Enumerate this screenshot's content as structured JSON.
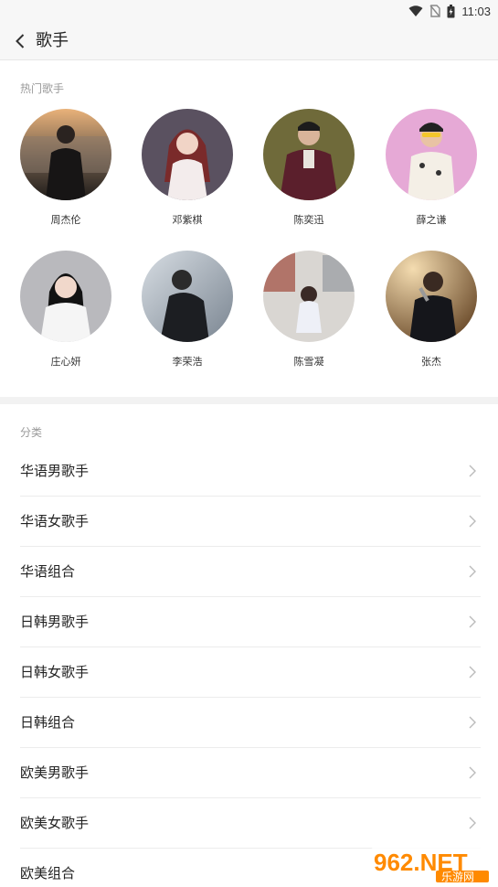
{
  "status_bar": {
    "time": "11:03"
  },
  "header": {
    "title": "歌手"
  },
  "hot_artists": {
    "label": "热门歌手",
    "items": [
      {
        "name": "周杰伦",
        "icon": "artist-photo"
      },
      {
        "name": "邓紫棋",
        "icon": "artist-photo"
      },
      {
        "name": "陈奕迅",
        "icon": "artist-photo"
      },
      {
        "name": "薛之谦",
        "icon": "artist-photo"
      },
      {
        "name": "庄心妍",
        "icon": "artist-photo"
      },
      {
        "name": "李荣浩",
        "icon": "artist-photo"
      },
      {
        "name": "陈雪凝",
        "icon": "artist-photo"
      },
      {
        "name": "张杰",
        "icon": "artist-photo"
      }
    ]
  },
  "categories": {
    "label": "分类",
    "items": [
      {
        "label": "华语男歌手"
      },
      {
        "label": "华语女歌手"
      },
      {
        "label": "华语组合"
      },
      {
        "label": "日韩男歌手"
      },
      {
        "label": "日韩女歌手"
      },
      {
        "label": "日韩组合"
      },
      {
        "label": "欧美男歌手"
      },
      {
        "label": "欧美女歌手"
      },
      {
        "label": "欧美组合"
      }
    ]
  },
  "watermark": {
    "main": "962.NET",
    "sub": "乐游网"
  },
  "colors": {
    "background": "#ffffff",
    "bar": "#f7f7f7",
    "muted_text": "#9a9a9a",
    "divider": "#ececec",
    "watermark": "#ff8a00"
  }
}
